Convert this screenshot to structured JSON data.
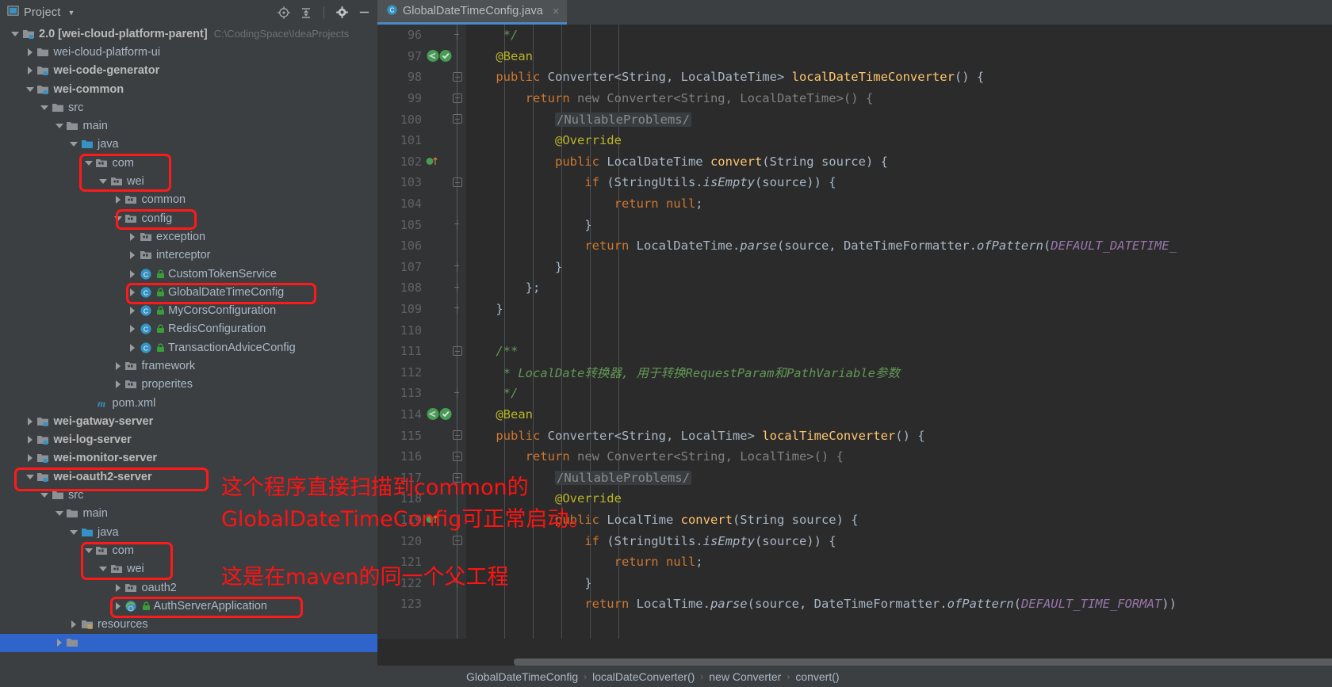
{
  "window": {
    "tool_window_title": "Project",
    "toolbar_icons": [
      "locate-icon",
      "collapse-all-icon",
      "settings-gear-icon",
      "minimize-icon"
    ]
  },
  "sidebar": {
    "tree": [
      {
        "indent": 0,
        "twisty": "open",
        "icon": "module-folder-icon",
        "label": "2.0 [wei-cloud-platform-parent]",
        "bold": true,
        "path": "C:\\CodingSpace\\IdeaProjects"
      },
      {
        "indent": 1,
        "twisty": "closed",
        "icon": "folder-icon",
        "label": "wei-cloud-platform-ui",
        "bold": false
      },
      {
        "indent": 1,
        "twisty": "closed",
        "icon": "module-folder-icon",
        "label": "wei-code-generator",
        "bold": true
      },
      {
        "indent": 1,
        "twisty": "open",
        "icon": "module-folder-icon",
        "label": "wei-common",
        "bold": true
      },
      {
        "indent": 2,
        "twisty": "open",
        "icon": "folder-icon",
        "label": "src",
        "bold": false
      },
      {
        "indent": 3,
        "twisty": "open",
        "icon": "folder-icon",
        "label": "main",
        "bold": false
      },
      {
        "indent": 4,
        "twisty": "open",
        "icon": "source-root-icon",
        "label": "java",
        "bold": false
      },
      {
        "indent": 5,
        "twisty": "open",
        "icon": "package-icon",
        "label": "com",
        "bold": false
      },
      {
        "indent": 6,
        "twisty": "open",
        "icon": "package-icon",
        "label": "wei",
        "bold": false
      },
      {
        "indent": 7,
        "twisty": "closed",
        "icon": "package-icon",
        "label": "common",
        "bold": false
      },
      {
        "indent": 7,
        "twisty": "open",
        "icon": "package-icon",
        "label": "config",
        "bold": false
      },
      {
        "indent": 8,
        "twisty": "closed",
        "icon": "package-icon",
        "label": "exception",
        "bold": false
      },
      {
        "indent": 8,
        "twisty": "closed",
        "icon": "package-icon",
        "label": "interceptor",
        "bold": false
      },
      {
        "indent": 8,
        "twisty": "closed",
        "icon": "java-class-icon",
        "label": "CustomTokenService",
        "bold": false,
        "lock": true
      },
      {
        "indent": 8,
        "twisty": "closed",
        "icon": "java-class-icon",
        "label": "GlobalDateTimeConfig",
        "bold": false,
        "lock": true
      },
      {
        "indent": 8,
        "twisty": "closed",
        "icon": "java-class-icon",
        "label": "MyCorsConfiguration",
        "bold": false,
        "lock": true
      },
      {
        "indent": 8,
        "twisty": "closed",
        "icon": "java-class-icon",
        "label": "RedisConfiguration",
        "bold": false,
        "lock": true
      },
      {
        "indent": 8,
        "twisty": "closed",
        "icon": "java-class-icon",
        "label": "TransactionAdviceConfig",
        "bold": false,
        "lock": true
      },
      {
        "indent": 7,
        "twisty": "closed",
        "icon": "package-icon",
        "label": "framework",
        "bold": false
      },
      {
        "indent": 7,
        "twisty": "closed",
        "icon": "package-icon",
        "label": "properites",
        "bold": false
      },
      {
        "indent": 5,
        "twisty": "none",
        "icon": "maven-pom-icon",
        "label": "pom.xml",
        "bold": false
      },
      {
        "indent": 1,
        "twisty": "closed",
        "icon": "module-folder-icon",
        "label": "wei-gatway-server",
        "bold": true
      },
      {
        "indent": 1,
        "twisty": "closed",
        "icon": "module-folder-icon",
        "label": "wei-log-server",
        "bold": true
      },
      {
        "indent": 1,
        "twisty": "closed",
        "icon": "module-folder-icon",
        "label": "wei-monitor-server",
        "bold": true
      },
      {
        "indent": 1,
        "twisty": "open",
        "icon": "module-folder-icon",
        "label": "wei-oauth2-server",
        "bold": true
      },
      {
        "indent": 2,
        "twisty": "open",
        "icon": "folder-icon",
        "label": "src",
        "bold": false
      },
      {
        "indent": 3,
        "twisty": "open",
        "icon": "folder-icon",
        "label": "main",
        "bold": false
      },
      {
        "indent": 4,
        "twisty": "open",
        "icon": "source-root-icon",
        "label": "java",
        "bold": false
      },
      {
        "indent": 5,
        "twisty": "open",
        "icon": "package-icon",
        "label": "com",
        "bold": false
      },
      {
        "indent": 6,
        "twisty": "open",
        "icon": "package-icon",
        "label": "wei",
        "bold": false
      },
      {
        "indent": 7,
        "twisty": "closed",
        "icon": "package-icon",
        "label": "oauth2",
        "bold": false
      },
      {
        "indent": 7,
        "twisty": "closed",
        "icon": "spring-class-icon",
        "label": "AuthServerApplication",
        "bold": false,
        "lock": true
      },
      {
        "indent": 4,
        "twisty": "closed",
        "icon": "resources-root-icon",
        "label": "resources",
        "bold": false
      },
      {
        "indent": 3,
        "twisty": "closed",
        "icon": "folder-icon",
        "label": "",
        "bold": false,
        "selected": true
      }
    ]
  },
  "annotations": {
    "note1": "这个程序直接扫描到common的",
    "note2": "GlobalDateTimeConfig可正常启动。",
    "note3": "这是在maven的同一个父工程",
    "highlight_color": "#ff1a1a"
  },
  "editor": {
    "tab": {
      "label": "GlobalDateTimeConfig.java",
      "icon": "java-class-icon",
      "close": "×"
    },
    "breadcrumb": [
      "GlobalDateTimeConfig",
      "localDateConverter()",
      "new Converter",
      "convert()"
    ],
    "first_line": 96,
    "lines": [
      {
        "n": 96,
        "fold": "bottom",
        "indent": 1,
        "tokens": [
          {
            "t": "     ",
            "c": "pln"
          },
          {
            "t": "*/",
            "c": "cmt"
          }
        ]
      },
      {
        "n": 97,
        "run": true,
        "indent": 1,
        "tokens": [
          {
            "t": "    ",
            "c": "pln"
          },
          {
            "t": "@Bean",
            "c": "ann"
          }
        ]
      },
      {
        "n": 98,
        "fold": "top",
        "indent": 1,
        "tokens": [
          {
            "t": "    ",
            "c": "pln"
          },
          {
            "t": "public ",
            "c": "kw"
          },
          {
            "t": "Converter<String, LocalDateTime> ",
            "c": "typ"
          },
          {
            "t": "localDateTimeConverter",
            "c": "mth"
          },
          {
            "t": "() {",
            "c": "pln"
          }
        ]
      },
      {
        "n": 99,
        "fold": "top",
        "indent": 2,
        "tokens": [
          {
            "t": "        ",
            "c": "pln"
          },
          {
            "t": "return ",
            "c": "kw"
          },
          {
            "t": "new Converter<String, LocalDateTime>() {",
            "c": "dim"
          }
        ]
      },
      {
        "n": 100,
        "fold": "top",
        "indent": 3,
        "tokens": [
          {
            "t": "            ",
            "c": "pln"
          },
          {
            "t": "/NullableProblems/",
            "c": "fold-ph"
          }
        ]
      },
      {
        "n": 101,
        "indent": 3,
        "tokens": [
          {
            "t": "            ",
            "c": "pln"
          },
          {
            "t": "@Override",
            "c": "ann"
          }
        ]
      },
      {
        "n": 102,
        "override": true,
        "indent": 3,
        "tokens": [
          {
            "t": "            ",
            "c": "pln"
          },
          {
            "t": "public ",
            "c": "kw"
          },
          {
            "t": "LocalDateTime ",
            "c": "typ"
          },
          {
            "t": "convert",
            "c": "mth"
          },
          {
            "t": "(String source) {",
            "c": "pln"
          }
        ]
      },
      {
        "n": 103,
        "fold": "top",
        "indent": 4,
        "tokens": [
          {
            "t": "                ",
            "c": "pln"
          },
          {
            "t": "if ",
            "c": "kw"
          },
          {
            "t": "(StringUtils.",
            "c": "pln"
          },
          {
            "t": "isEmpty",
            "c": "stat"
          },
          {
            "t": "(source)) {",
            "c": "pln"
          }
        ]
      },
      {
        "n": 104,
        "indent": 5,
        "tokens": [
          {
            "t": "                    ",
            "c": "pln"
          },
          {
            "t": "return null",
            "c": "kw"
          },
          {
            "t": ";",
            "c": "pln"
          }
        ]
      },
      {
        "n": 105,
        "fold": "bottom",
        "indent": 4,
        "tokens": [
          {
            "t": "                ",
            "c": "pln"
          },
          {
            "t": "}",
            "c": "pln"
          }
        ]
      },
      {
        "n": 106,
        "indent": 4,
        "tokens": [
          {
            "t": "                ",
            "c": "pln"
          },
          {
            "t": "return ",
            "c": "kw"
          },
          {
            "t": "LocalDateTime.",
            "c": "pln"
          },
          {
            "t": "parse",
            "c": "stat"
          },
          {
            "t": "(source, DateTimeFormatter.",
            "c": "pln"
          },
          {
            "t": "ofPattern",
            "c": "stat"
          },
          {
            "t": "(",
            "c": "pln"
          },
          {
            "t": "DEFAULT_DATETIME_",
            "c": "cnst"
          }
        ]
      },
      {
        "n": 107,
        "fold": "bottom",
        "indent": 3,
        "tokens": [
          {
            "t": "            ",
            "c": "pln"
          },
          {
            "t": "}",
            "c": "pln"
          }
        ]
      },
      {
        "n": 108,
        "fold": "bottom",
        "indent": 2,
        "tokens": [
          {
            "t": "        ",
            "c": "pln"
          },
          {
            "t": "};",
            "c": "pln"
          }
        ]
      },
      {
        "n": 109,
        "fold": "bottom",
        "indent": 1,
        "tokens": [
          {
            "t": "    ",
            "c": "pln"
          },
          {
            "t": "}",
            "c": "pln"
          }
        ]
      },
      {
        "n": 110,
        "indent": 1,
        "tokens": []
      },
      {
        "n": 111,
        "fold": "top",
        "indent": 1,
        "tokens": [
          {
            "t": "    ",
            "c": "pln"
          },
          {
            "t": "/**",
            "c": "cmt"
          }
        ]
      },
      {
        "n": 112,
        "indent": 1,
        "tokens": [
          {
            "t": "     ",
            "c": "pln"
          },
          {
            "t": "* LocalDate转换器, 用于转换RequestParam和PathVariable参数",
            "c": "cmt"
          }
        ]
      },
      {
        "n": 113,
        "fold": "bottom",
        "indent": 1,
        "tokens": [
          {
            "t": "     ",
            "c": "pln"
          },
          {
            "t": "*/",
            "c": "cmt"
          }
        ]
      },
      {
        "n": 114,
        "run": true,
        "indent": 1,
        "tokens": [
          {
            "t": "    ",
            "c": "pln"
          },
          {
            "t": "@Bean",
            "c": "ann"
          }
        ]
      },
      {
        "n": 115,
        "fold": "top",
        "indent": 1,
        "tokens": [
          {
            "t": "    ",
            "c": "pln"
          },
          {
            "t": "public ",
            "c": "kw"
          },
          {
            "t": "Converter<String, LocalTime> ",
            "c": "typ"
          },
          {
            "t": "localTimeConverter",
            "c": "mth"
          },
          {
            "t": "() {",
            "c": "pln"
          }
        ]
      },
      {
        "n": 116,
        "fold": "top",
        "indent": 2,
        "tokens": [
          {
            "t": "        ",
            "c": "pln"
          },
          {
            "t": "return ",
            "c": "kw"
          },
          {
            "t": "new Converter<String, LocalTime>() {",
            "c": "dim"
          }
        ]
      },
      {
        "n": 117,
        "fold": "top",
        "indent": 3,
        "tokens": [
          {
            "t": "            ",
            "c": "pln"
          },
          {
            "t": "/NullableProblems/",
            "c": "fold-ph"
          }
        ]
      },
      {
        "n": 118,
        "indent": 3,
        "tokens": [
          {
            "t": "            ",
            "c": "pln"
          },
          {
            "t": "@Override",
            "c": "ann"
          }
        ]
      },
      {
        "n": 119,
        "override": true,
        "indent": 3,
        "tokens": [
          {
            "t": "            ",
            "c": "pln"
          },
          {
            "t": "public ",
            "c": "kw"
          },
          {
            "t": "LocalTime ",
            "c": "typ"
          },
          {
            "t": "convert",
            "c": "mth"
          },
          {
            "t": "(String source) {",
            "c": "pln"
          }
        ]
      },
      {
        "n": 120,
        "fold": "top",
        "indent": 4,
        "tokens": [
          {
            "t": "                ",
            "c": "pln"
          },
          {
            "t": "if ",
            "c": "kw"
          },
          {
            "t": "(StringUtils.",
            "c": "pln"
          },
          {
            "t": "isEmpty",
            "c": "stat"
          },
          {
            "t": "(source)) {",
            "c": "pln"
          }
        ]
      },
      {
        "n": 121,
        "indent": 5,
        "tokens": [
          {
            "t": "                    ",
            "c": "pln"
          },
          {
            "t": "return null",
            "c": "kw"
          },
          {
            "t": ";",
            "c": "pln"
          }
        ]
      },
      {
        "n": 122,
        "fold": "bottom",
        "indent": 4,
        "tokens": [
          {
            "t": "                ",
            "c": "pln"
          },
          {
            "t": "}",
            "c": "pln"
          }
        ]
      },
      {
        "n": 123,
        "indent": 4,
        "tokens": [
          {
            "t": "                ",
            "c": "pln"
          },
          {
            "t": "return ",
            "c": "kw"
          },
          {
            "t": "LocalTime.",
            "c": "pln"
          },
          {
            "t": "parse",
            "c": "stat"
          },
          {
            "t": "(source, DateTimeFormatter.",
            "c": "pln"
          },
          {
            "t": "ofPattern",
            "c": "stat"
          },
          {
            "t": "(",
            "c": "pln"
          },
          {
            "t": "DEFAULT_TIME_FORMAT",
            "c": "cnst"
          },
          {
            "t": "))",
            "c": "pln"
          }
        ]
      }
    ]
  },
  "colors": {
    "editor_bg": "#2b2b2b",
    "gutter_bg": "#313335",
    "panel_bg": "#3c3f41",
    "tab_active_underline": "#4a88c7",
    "selection_blue": "#2f65ca",
    "annotation_red": "#ff1a1a"
  }
}
